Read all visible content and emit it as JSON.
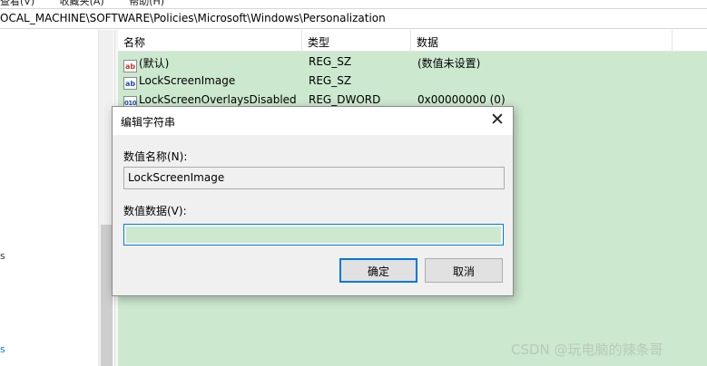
{
  "menu": {
    "items": [
      "查看(V)",
      "收藏夹(A)",
      "帮助(H)"
    ]
  },
  "address": {
    "path": "OCAL_MACHINE\\SOFTWARE\\Policies\\Microsoft\\Windows\\Personalization"
  },
  "tree": {
    "fragments": [
      "s",
      "s"
    ]
  },
  "list": {
    "headers": {
      "name": "名称",
      "type": "类型",
      "data": "数据"
    },
    "rows": [
      {
        "icon": "string-value-icon",
        "name": "(默认)",
        "type": "REG_SZ",
        "data": "(数值未设置)"
      },
      {
        "icon": "string-value-icon",
        "name": "LockScreenImage",
        "type": "REG_SZ",
        "data": ""
      },
      {
        "icon": "dword-value-icon",
        "name": "LockScreenOverlaysDisabled",
        "type": "REG_DWORD",
        "data": "0x00000000 (0)"
      }
    ]
  },
  "dialog": {
    "title": "编辑字符串",
    "close_glyph": "✕",
    "value_name_label": "数值名称(N):",
    "value_name": "LockScreenImage",
    "value_data_label": "数值数据(V):",
    "value_data": "",
    "ok_label": "确定",
    "cancel_label": "取消"
  },
  "watermark": "CSDN @玩电脑的辣条哥",
  "colors": {
    "list_background": "#cce8cf",
    "accent": "#0078d7"
  }
}
